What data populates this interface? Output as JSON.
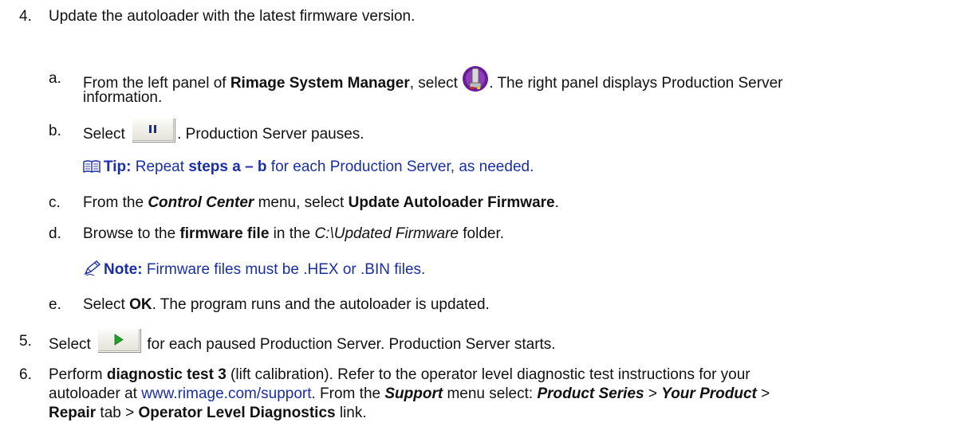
{
  "step4": {
    "num": "4.",
    "text": "Update the autoloader with the latest firmware version."
  },
  "sub_a": {
    "letter": "a.",
    "t1": "From the left panel of ",
    "b1": "Rimage System Manager",
    "t2": ", select ",
    "t3": ". The right panel displays Production Server",
    "t4": "information.",
    "icon": "production-server-icon"
  },
  "sub_b": {
    "letter": "b.",
    "t1": "Select ",
    "t2": ". Production Server pauses.",
    "icon": "pause-icon"
  },
  "tip": {
    "label": "Tip:",
    "t1": " Repeat ",
    "b1": "steps a – b",
    "t2": " for each Production Server, as needed.",
    "icon": "book-icon"
  },
  "sub_c": {
    "letter": "c.",
    "t1": "From the ",
    "bi1": "Control Center",
    "t2": " menu, select ",
    "b1": "Update Autoloader Firmware",
    "t3": "."
  },
  "sub_d": {
    "letter": "d.",
    "t1": "Browse to the ",
    "b1": "firmware file",
    "t2": " in the ",
    "i1": "C:\\Updated Firmware",
    "t3": " folder."
  },
  "note": {
    "label": "Note:",
    "t1": " Firmware files must be .HEX or .BIN files.",
    "icon": "pencil-icon"
  },
  "sub_e": {
    "letter": "e.",
    "t1": "Select ",
    "b1": "OK",
    "t2": ". The program runs and the autoloader is updated."
  },
  "step5": {
    "num": "5.",
    "t1": "Select ",
    "t2": " for each paused Production Server. Production Server starts.",
    "icon": "play-icon"
  },
  "step6": {
    "num": "6.",
    "t1": "Perform ",
    "b1": "diagnostic test 3",
    "t2": " (lift calibration). Refer to the operator level diagnostic test instructions for your",
    "t3": "autoloader at ",
    "link": "www.rimage.com/support",
    "t4": ". From the ",
    "bi1": "Support",
    "t5": " menu select: ",
    "bi2": "Product Series",
    "t6": " > ",
    "bi3": "Your Product",
    "t7": " >",
    "b2": "Repair",
    "t8": " tab > ",
    "b3": "Operator Level Diagnostics",
    "t9": " link."
  },
  "colors": {
    "text": "#111111",
    "accent_blue": "#1a2ea6",
    "server_icon_purple": "#6a1b9a",
    "play_green": "#22a22a"
  }
}
